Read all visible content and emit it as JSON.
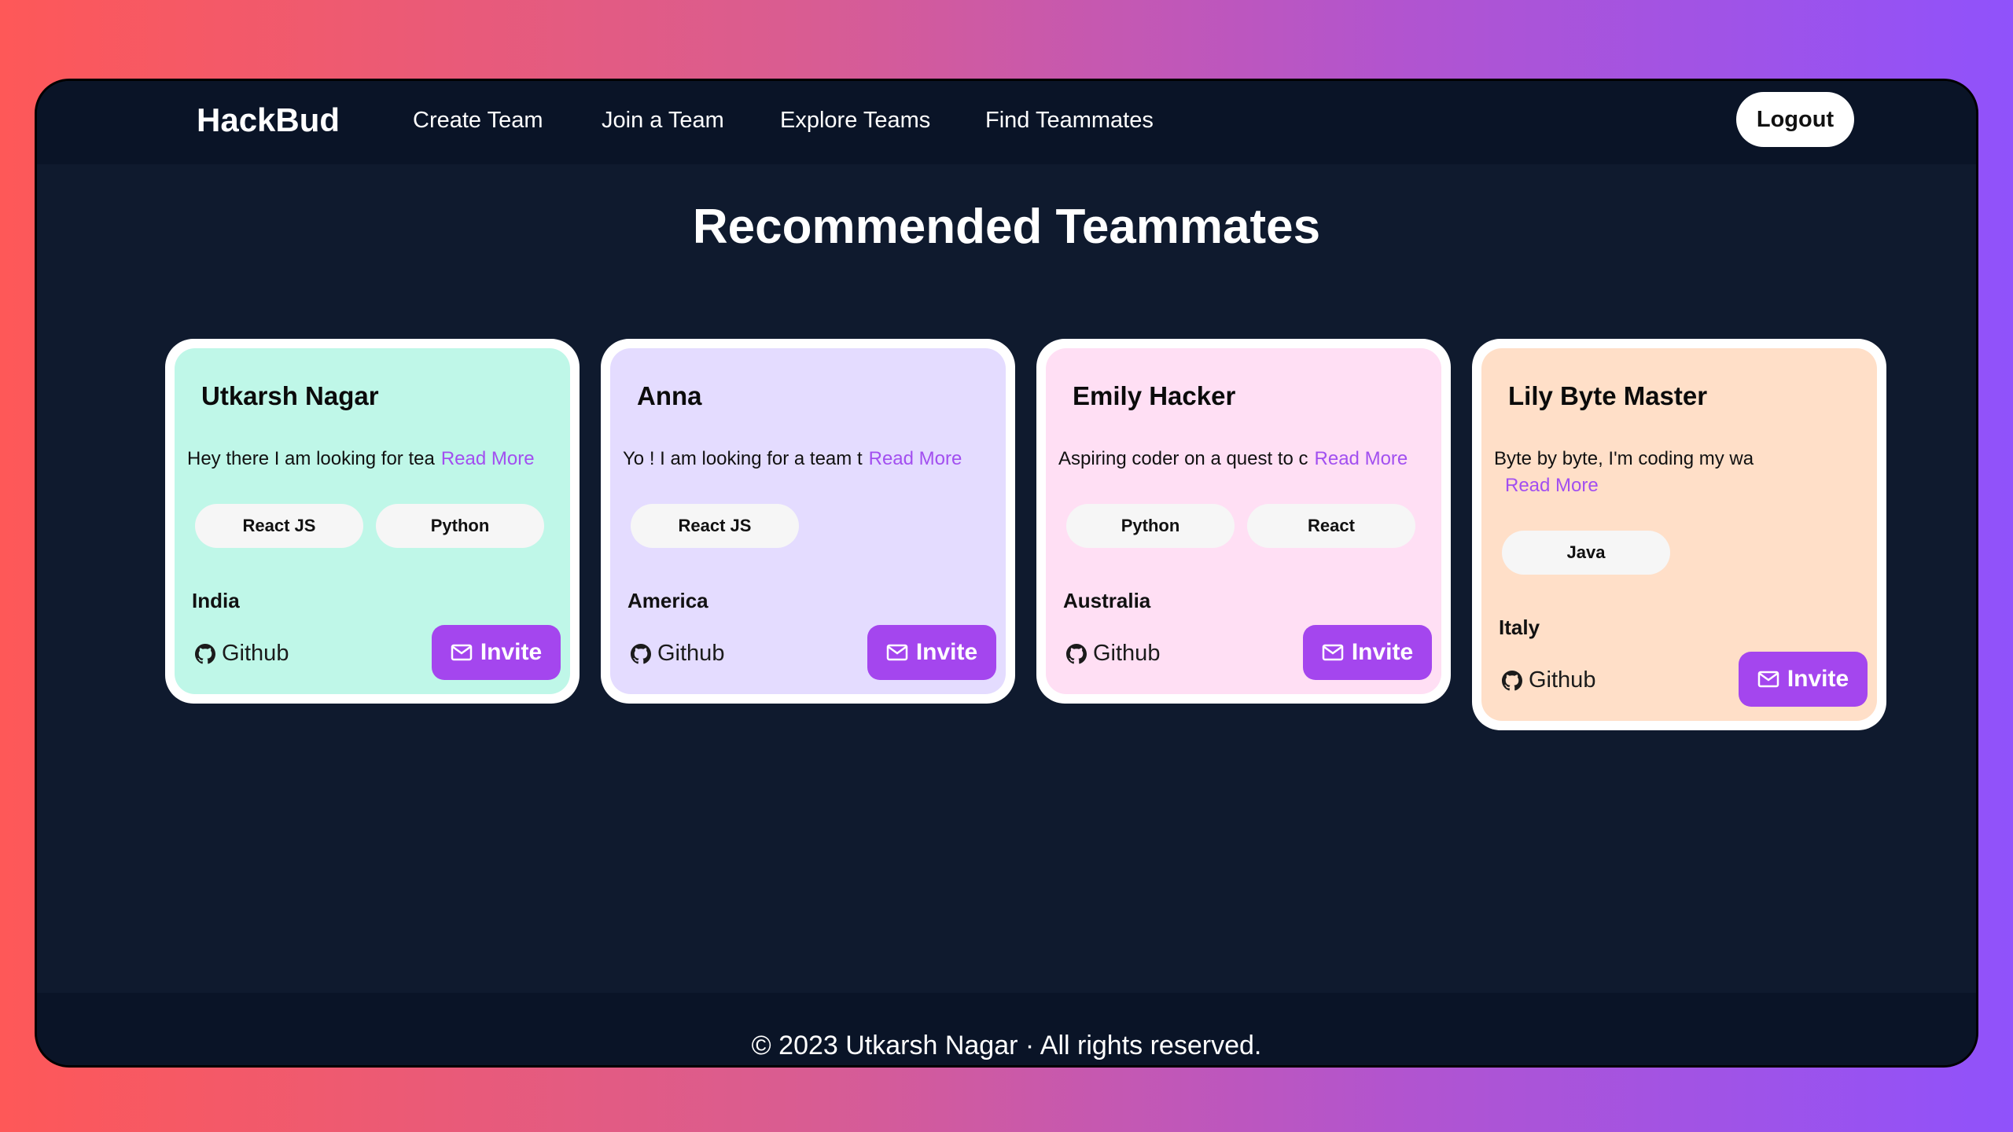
{
  "navbar": {
    "brand": "HackBud",
    "links": [
      "Create Team",
      "Join a Team",
      "Explore Teams",
      "Find Teammates"
    ],
    "logout_label": "Logout"
  },
  "page_title": "Recommended Teammates",
  "cards": [
    {
      "name": "Utkarsh Nagar",
      "bio": "Hey there I am looking for tea",
      "read_more": "Read More",
      "tags": [
        "React JS",
        "Python"
      ],
      "country": "India",
      "github_label": "Github",
      "invite_label": "Invite",
      "color": "#bff7e8"
    },
    {
      "name": "Anna",
      "bio": "Yo ! I am looking for a team t",
      "read_more": "Read More",
      "tags": [
        "React JS"
      ],
      "country": "America",
      "github_label": "Github",
      "invite_label": "Invite",
      "color": "#e4dcff"
    },
    {
      "name": "Emily Hacker",
      "bio": "Aspiring coder on a quest to c",
      "read_more": "Read More",
      "tags": [
        "Python",
        "React"
      ],
      "country": "Australia",
      "github_label": "Github",
      "invite_label": "Invite",
      "color": "#ffdff4"
    },
    {
      "name": "Lily Byte Master",
      "bio": "Byte by byte, I'm coding my wa",
      "read_more": "Read More",
      "tags": [
        "Java"
      ],
      "country": "Italy",
      "github_label": "Github",
      "invite_label": "Invite",
      "color": "#ffdfc8"
    }
  ],
  "footer": {
    "text": "© 2023 Utkarsh Nagar · All rights reserved."
  },
  "colors": {
    "accent": "#a446ee",
    "background": "#0f1a2e",
    "navbar": "#0a1427"
  },
  "icons": {
    "github": "github-icon",
    "invite": "mail-icon"
  }
}
